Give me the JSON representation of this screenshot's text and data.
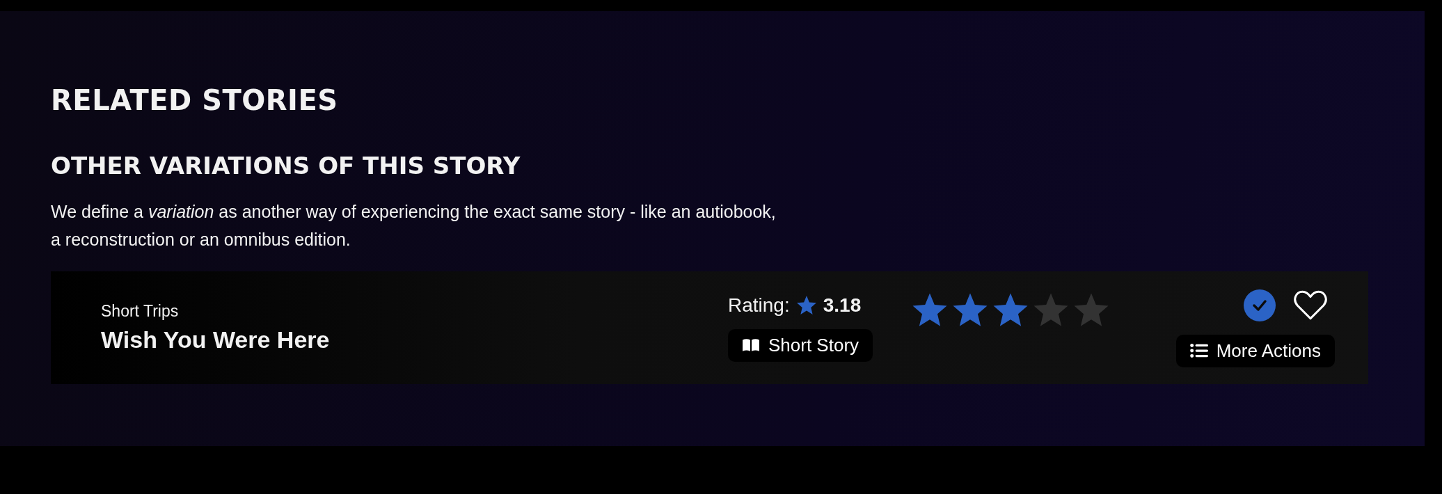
{
  "section_title": "RELATED STORIES",
  "subsection_title": "OTHER VARIATIONS OF THIS STORY",
  "description": "We define a *variation* as another way of experiencing the exact same story - like an autiobook, a reconstruction or an omnibus edition.",
  "cards": [
    {
      "series": "Short Trips",
      "title": "Wish You Were Here",
      "rating_label": "Rating:",
      "rating": "3.18",
      "stars": 3,
      "format": "Short Story",
      "checked": true,
      "favorited": false,
      "more_actions": "More Actions"
    }
  ]
}
